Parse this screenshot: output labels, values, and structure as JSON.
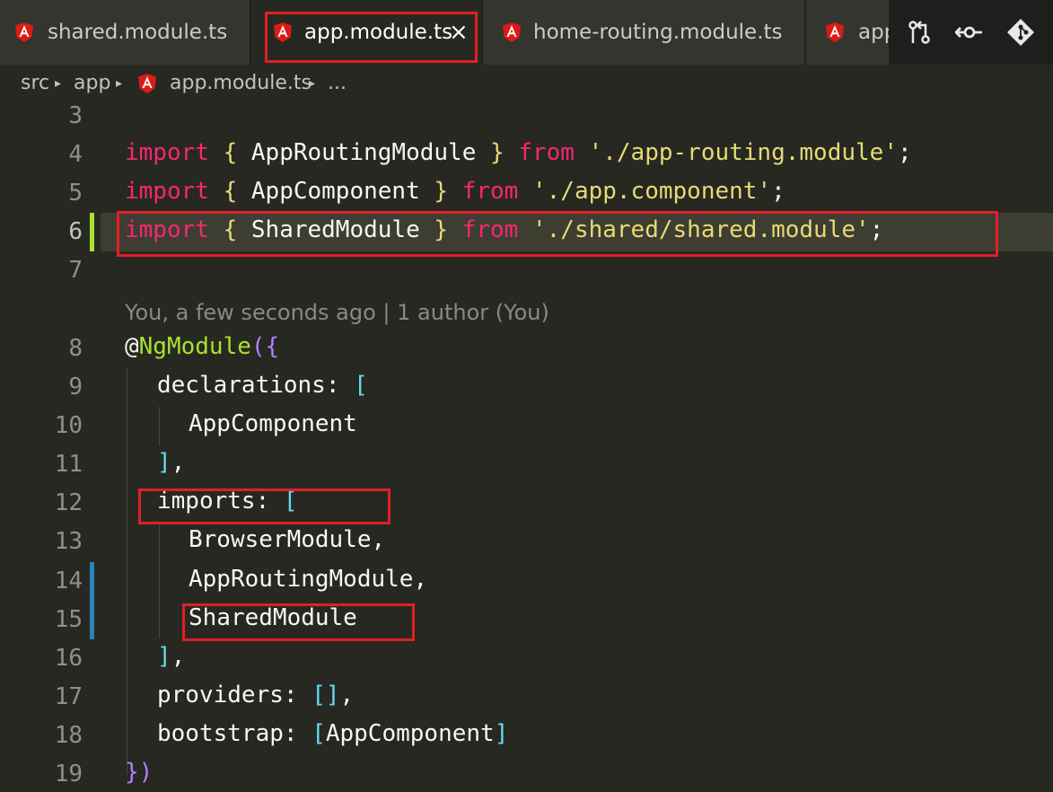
{
  "tabs": [
    {
      "label": "shared.module.ts",
      "active": false
    },
    {
      "label": "app.module.ts",
      "active": true,
      "close": "×"
    },
    {
      "label": "home-routing.module.ts",
      "active": false
    },
    {
      "label": "app",
      "active": false
    }
  ],
  "actions": [
    "compare-changes-icon",
    "open-changes-icon",
    "git-icon"
  ],
  "breadcrumb": {
    "items": [
      "src",
      "app",
      "app.module.ts",
      "..."
    ],
    "separator": "▸"
  },
  "blame": "You, a few seconds ago | 1 author (You)",
  "lines": {
    "n3": "3",
    "n4": "4",
    "n5": "5",
    "n6": "6",
    "n7": "7",
    "n8": "8",
    "n9": "9",
    "n10": "10",
    "n11": "11",
    "n12": "12",
    "n13": "13",
    "n14": "14",
    "n15": "15",
    "n16": "16",
    "n17": "17",
    "n18": "18",
    "n19": "19"
  },
  "code": {
    "kw_import": "import",
    "kw_from": "from",
    "l4_name": " AppRoutingModule ",
    "l4_path": "'./app-routing.module'",
    "l5_name": " AppComponent ",
    "l5_path": "'./app.component'",
    "l6_name": " SharedModule ",
    "l6_path": "'./shared/shared.module'",
    "semi": ";",
    "ob": "{",
    "cb": "}",
    "at": "@",
    "decorator": "NgModule",
    "paren_open": "(",
    "paren_close": ")",
    "declarations": "declarations: ",
    "app_component": "AppComponent",
    "close_bracket_comma": "],",
    "imports": "imports: ",
    "open_bracket": "[",
    "browser_module": "BrowserModule,",
    "app_routing_module": "AppRoutingModule,",
    "shared_module": "SharedModule",
    "providers": "providers: ",
    "providers_value": "[]",
    "comma": ",",
    "bootstrap": "bootstrap: ",
    "bootstrap_value": "AppComponent",
    "close_bracket": "]"
  },
  "colors": {
    "highlight": "#e01f26",
    "angular": "#dd1b16",
    "keyword": "#f92672",
    "string": "#e6db74",
    "decorator": "#a6e22e",
    "bracket": "#66d9ef",
    "paren": "#ae81ff"
  }
}
